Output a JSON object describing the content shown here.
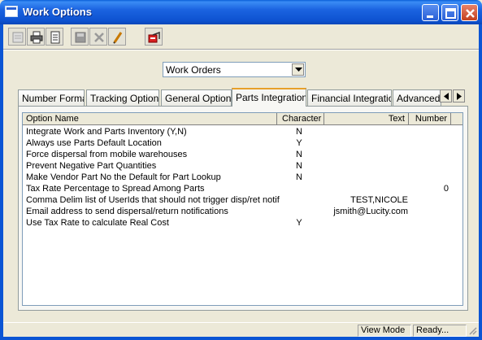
{
  "window": {
    "title": "Work Options"
  },
  "toolbar": {
    "buttons": [
      {
        "name": "new-icon"
      },
      {
        "name": "print-icon"
      },
      {
        "name": "preview-icon"
      },
      {
        "name": "save-icon"
      },
      {
        "name": "delete-icon"
      },
      {
        "name": "edit-icon"
      },
      {
        "name": "exit-icon"
      }
    ]
  },
  "selector": {
    "value": "Work Orders"
  },
  "tabs": [
    {
      "label": "Number Format"
    },
    {
      "label": "Tracking Options"
    },
    {
      "label": "General Options"
    },
    {
      "label": "Parts Integration",
      "active": true
    },
    {
      "label": "Financial Integration"
    },
    {
      "label": "Advanced O"
    }
  ],
  "grid": {
    "columns": [
      "Option Name",
      "Character",
      "Text",
      "Number"
    ],
    "rows": [
      {
        "name": "Integrate Work and Parts Inventory (Y,N)",
        "char": "N",
        "text": "",
        "number": ""
      },
      {
        "name": "Always use Parts Default Location",
        "char": "Y",
        "text": "",
        "number": ""
      },
      {
        "name": "Force dispersal from mobile warehouses",
        "char": "N",
        "text": "",
        "number": ""
      },
      {
        "name": "Prevent Negative Part Quantities",
        "char": "N",
        "text": "",
        "number": ""
      },
      {
        "name": "Make Vendor Part No the Default for Part Lookup",
        "char": "N",
        "text": "",
        "number": ""
      },
      {
        "name": "Tax Rate Percentage to Spread Among Parts",
        "char": "",
        "text": "",
        "number": "0"
      },
      {
        "name": "Comma Delim list of UserIds that should not trigger disp/ret notif",
        "char": "",
        "text": "TEST,NICOLE",
        "number": ""
      },
      {
        "name": "Email address to send dispersal/return notifications",
        "char": "",
        "text": "jsmith@Lucity.com",
        "number": ""
      },
      {
        "name": "Use Tax Rate to calculate Real Cost",
        "char": "Y",
        "text": "",
        "number": ""
      }
    ]
  },
  "status": {
    "mode": "View Mode",
    "state": "Ready..."
  }
}
